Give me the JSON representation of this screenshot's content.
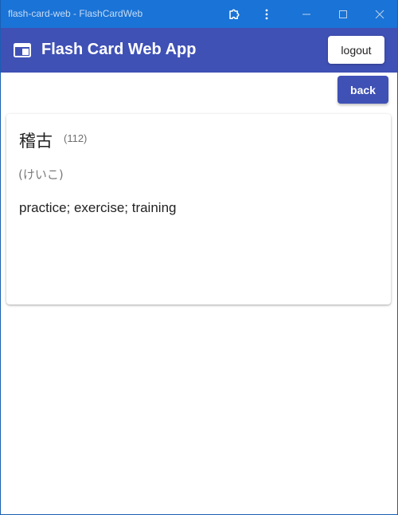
{
  "window": {
    "title": "flash-card-web - FlashCardWeb"
  },
  "appbar": {
    "title": "Flash Card Web App",
    "logout_label": "logout",
    "icon": "web-window-icon"
  },
  "nav": {
    "back_label": "back"
  },
  "card": {
    "term": "稽古",
    "count": "(112)",
    "reading": "(けいこ)",
    "meaning": "practice; exercise; training"
  },
  "colors": {
    "titlebar": "#1a73d6",
    "appbar": "#3f51b5",
    "primary_button": "#3f51b5",
    "card_background": "#ffffff"
  }
}
